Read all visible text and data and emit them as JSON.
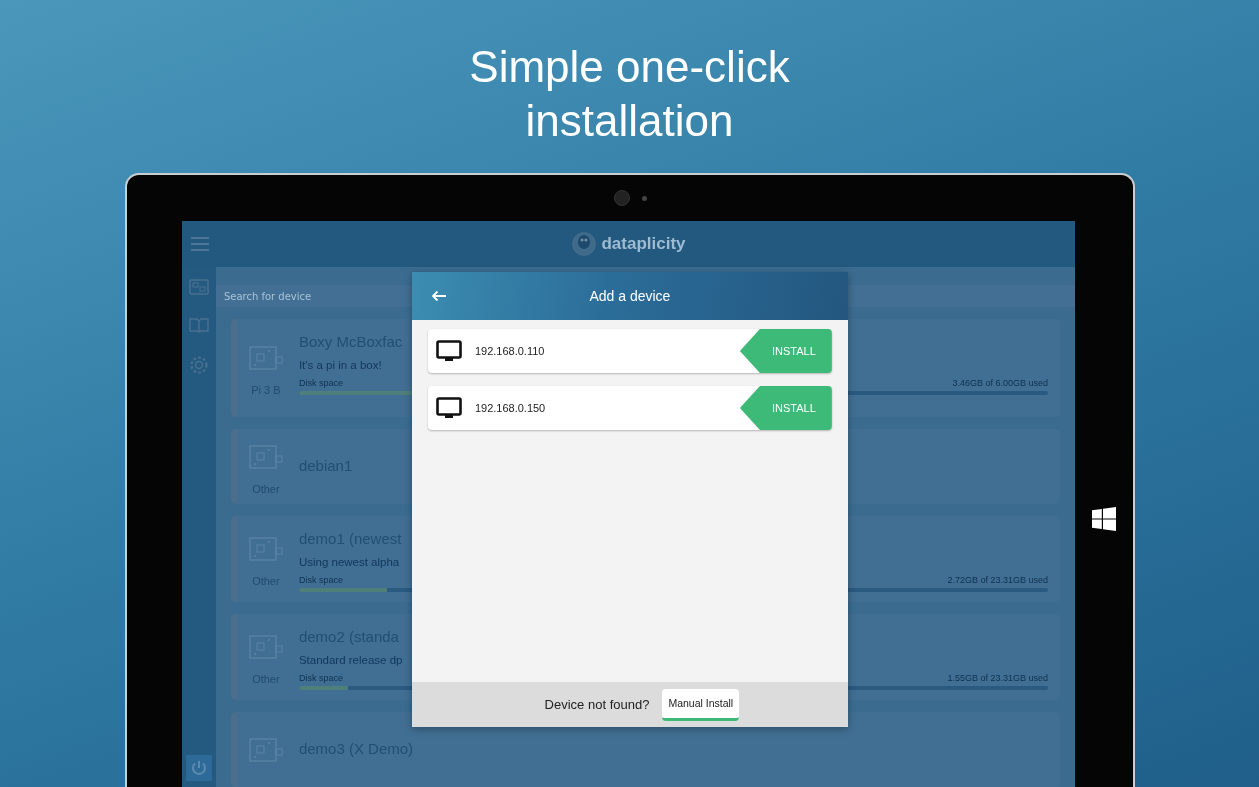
{
  "headline": "Simple one-click installation",
  "app": {
    "logo_text": "dataplicity",
    "search": {
      "placeholder": "Search for device"
    },
    "devices": [
      {
        "name": "Boxy McBoxfac",
        "description": "It's a pi in a box!",
        "type": "Pi 3 B",
        "disk_label": "Disk space",
        "disk_usage": "3.46GB of 6.00GB used",
        "level": 0.577
      },
      {
        "name": "debian1",
        "type": "Other"
      },
      {
        "name": "demo1 (newest",
        "description": "Using newest alpha",
        "type": "Other",
        "disk_label": "Disk space",
        "disk_usage": "2.72GB of 23.31GB used",
        "level": 0.117
      },
      {
        "name": "demo2 (standa",
        "description": "Standard release dp",
        "type": "Other",
        "disk_label": "Disk space",
        "disk_usage": "1.55GB of 23.31GB used",
        "level": 0.066
      },
      {
        "name": "demo3 (X Demo)"
      }
    ]
  },
  "dialog": {
    "title": "Add a device",
    "devices": [
      {
        "address": "192.168.0.110",
        "action": "INSTALL"
      },
      {
        "address": "192.168.0.150",
        "action": "INSTALL"
      }
    ],
    "footer": {
      "prompt": "Device not found?",
      "button": "Manual Install"
    }
  }
}
